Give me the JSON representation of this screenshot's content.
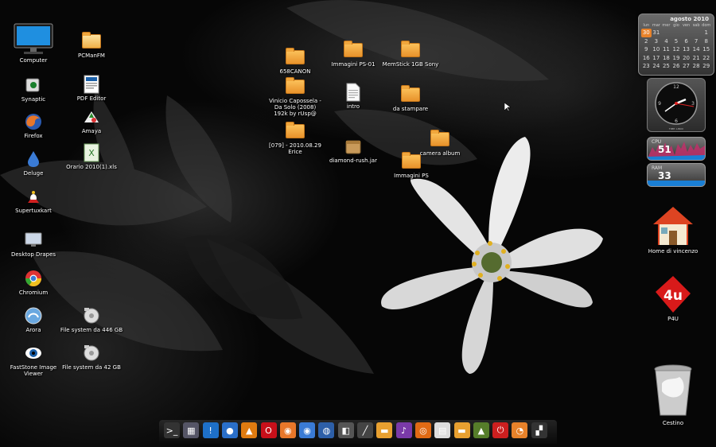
{
  "desktop": {
    "icons_left": [
      {
        "label": "Computer",
        "icon": "monitor-icon"
      },
      {
        "label": "Synaptic",
        "icon": "synaptic-icon"
      },
      {
        "label": "Firefox",
        "icon": "firefox-icon"
      },
      {
        "label": "Deluge",
        "icon": "deluge-icon"
      },
      {
        "label": "Supertuxkart",
        "icon": "supertuxkart-icon"
      },
      {
        "label": "Desktop Drapes",
        "icon": "desktop-drapes-icon"
      },
      {
        "label": "Chromium",
        "icon": "chromium-icon"
      },
      {
        "label": "Arora",
        "icon": "arora-icon"
      },
      {
        "label": "FastStone Image Viewer",
        "icon": "faststone-icon"
      }
    ],
    "icons_second_column": [
      {
        "label": "PCManFM",
        "icon": "folder-icon"
      },
      {
        "label": "PDF Editor",
        "icon": "pdf-icon"
      },
      {
        "label": "Amaya",
        "icon": "amaya-icon"
      },
      {
        "label": "Orario 2010(1).xls",
        "icon": "spreadsheet-icon"
      },
      {
        "label": "File system da 446 GB",
        "icon": "drive-icon"
      },
      {
        "label": "File system da 42 GB",
        "icon": "drive-icon"
      }
    ],
    "icons_center": [
      {
        "label": "658CANON",
        "icon": "folder-icon"
      },
      {
        "label": "Immagini PS-01",
        "icon": "folder-icon"
      },
      {
        "label": "MemStick 1GB Sony",
        "icon": "folder-icon"
      },
      {
        "label": "Vinicio Capossela - Da Solo (2008) 192k by rUsp@",
        "icon": "folder-icon"
      },
      {
        "label": "intro",
        "icon": "text-file-icon"
      },
      {
        "label": "da stampare",
        "icon": "folder-icon"
      },
      {
        "label": "[079] - 2010.08.29 Erice",
        "icon": "folder-icon"
      },
      {
        "label": "diamond-rush.jar",
        "icon": "jar-icon"
      },
      {
        "label": "camera album",
        "icon": "folder-icon"
      },
      {
        "label": "Immagini PS",
        "icon": "folder-icon"
      }
    ],
    "icons_right": [
      {
        "label": "Home di vincenzo",
        "icon": "home-icon"
      },
      {
        "label": "P4U",
        "icon": "p4u-icon"
      },
      {
        "label": "Cestino",
        "icon": "trash-icon"
      }
    ]
  },
  "widgets": {
    "calendar": {
      "title": "agosto 2010",
      "weekdays": [
        "lun",
        "mar",
        "mer",
        "gio",
        "ven",
        "sab",
        "dom"
      ],
      "days": [
        "30",
        "31",
        "",
        "",
        "",
        "",
        "1",
        "2",
        "3",
        "4",
        "5",
        "6",
        "7",
        "8",
        "9",
        "10",
        "11",
        "12",
        "13",
        "14",
        "15",
        "16",
        "17",
        "18",
        "19",
        "20",
        "21",
        "22",
        "23",
        "24",
        "25",
        "26",
        "27",
        "28",
        "29"
      ],
      "today": "30"
    },
    "clock": {
      "caption": "TIME: LINUX"
    },
    "cpu": {
      "label": "CPU",
      "value": "51"
    },
    "ram": {
      "label": "RAM",
      "value": "33"
    }
  },
  "dock": {
    "items": [
      {
        "icon": "terminal-icon",
        "symbol": ">_",
        "color": "#333"
      },
      {
        "icon": "calculator-icon",
        "symbol": "▦",
        "color": "#556"
      },
      {
        "icon": "chat-icon",
        "symbol": "!",
        "color": "#1e70c8"
      },
      {
        "icon": "deluge-icon",
        "symbol": "●",
        "color": "#2a6fc9"
      },
      {
        "icon": "vlc-icon",
        "symbol": "▲",
        "color": "#e07b10"
      },
      {
        "icon": "opera-icon",
        "symbol": "O",
        "color": "#c8101a"
      },
      {
        "icon": "firefox-icon",
        "symbol": "◉",
        "color": "#e8772a"
      },
      {
        "icon": "chromium-icon",
        "symbol": "◉",
        "color": "#3a7bd5"
      },
      {
        "icon": "globe-icon",
        "symbol": "◍",
        "color": "#2d5fa8"
      },
      {
        "icon": "photo-icon",
        "symbol": "◧",
        "color": "#555"
      },
      {
        "icon": "pen-icon",
        "symbol": "╱",
        "color": "#444"
      },
      {
        "icon": "files-icon",
        "symbol": "▬",
        "color": "#e8a030"
      },
      {
        "icon": "media-icon",
        "symbol": "♪",
        "color": "#7a3aa8"
      },
      {
        "icon": "ubuntu-icon",
        "symbol": "◎",
        "color": "#e06a14"
      },
      {
        "icon": "documents-icon",
        "symbol": "▤",
        "color": "#ddd"
      },
      {
        "icon": "folder-icon",
        "symbol": "▬",
        "color": "#e8a030"
      },
      {
        "icon": "photos-icon",
        "symbol": "▲",
        "color": "#567d2a"
      },
      {
        "icon": "power-icon",
        "symbol": "⏻",
        "color": "#cc1f1f"
      },
      {
        "icon": "rss-icon",
        "symbol": "◔",
        "color": "#e8822a"
      },
      {
        "icon": "movie-icon",
        "symbol": "▞",
        "color": "#333"
      }
    ]
  }
}
